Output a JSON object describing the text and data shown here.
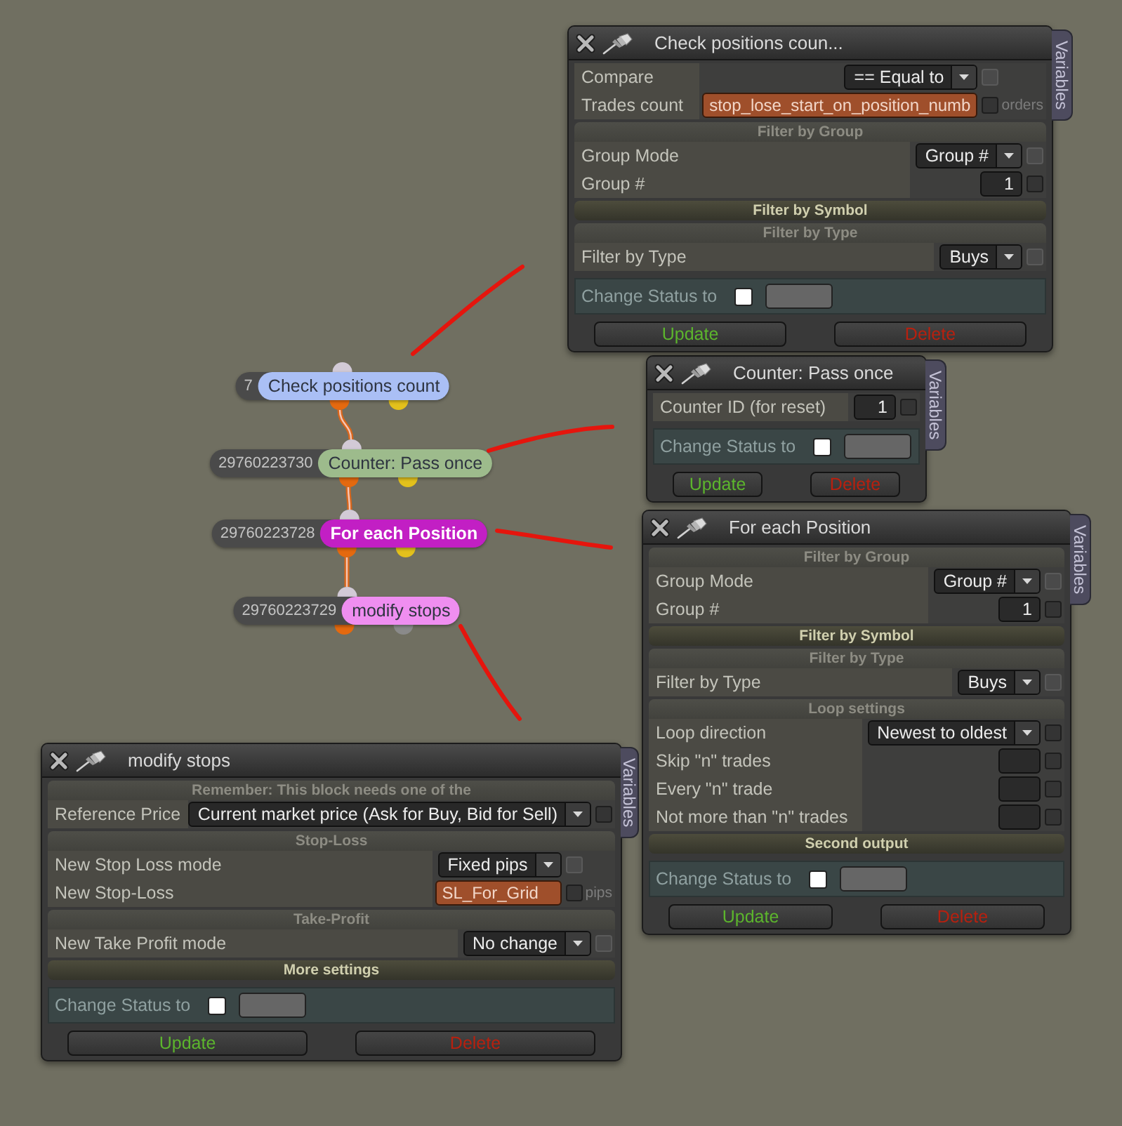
{
  "nodes": [
    {
      "id": "7",
      "label": "Check positions count",
      "color": "#aabff5",
      "selected": false,
      "second_port": {
        "color": "#e3c11c"
      }
    },
    {
      "id": "29760223730",
      "label": "Counter: Pass once",
      "color": "#9dbb8c",
      "selected": false,
      "second_port": {
        "color": "#e3c11c"
      }
    },
    {
      "id": "29760223728",
      "label": "For each Position",
      "color": "#c21fc4",
      "selected": true,
      "second_port": {
        "color": "#e3c11c"
      }
    },
    {
      "id": "29760223729",
      "label": "modify stops",
      "color": "#ef8ef0",
      "selected": false,
      "second_port": {
        "color": "#8a8a8a"
      }
    }
  ],
  "panels": [
    {
      "title": "Check positions coun...",
      "tab": "Variables",
      "sections": [
        {
          "rows": [
            {
              "label": "Compare",
              "kind": "select",
              "value": "== Equal to",
              "check": {
                "checked": false,
                "disabled": true
              }
            },
            {
              "label": "Trades count",
              "kind": "variable",
              "value": "stop_lose_start_on_position_numb",
              "check": {
                "checked": false,
                "disabled": false
              },
              "unit": "orders"
            }
          ]
        },
        {
          "title": "Filter by Group",
          "expanded": true,
          "rows": [
            {
              "label": "Group Mode",
              "kind": "select",
              "value": "Group #",
              "check": {
                "checked": false,
                "disabled": true
              }
            },
            {
              "label": "Group #",
              "kind": "input",
              "value": "1",
              "check": {
                "checked": false,
                "disabled": false
              }
            }
          ]
        },
        {
          "title": "Filter by Symbol",
          "expanded": false
        },
        {
          "title": "Filter by Type",
          "expanded": true,
          "rows": [
            {
              "label": "Filter by Type",
              "kind": "select",
              "value": "Buys",
              "check": {
                "checked": false,
                "disabled": true
              }
            }
          ]
        }
      ],
      "status": {
        "label": "Change Status to",
        "checked": false
      },
      "buttons": [
        {
          "label": "Update",
          "kind": "update"
        },
        {
          "label": "Delete",
          "kind": "delete"
        }
      ]
    },
    {
      "title": "Counter: Pass once",
      "tab": "Variables",
      "sections": [
        {
          "rows": [
            {
              "label": "Counter ID (for reset)",
              "kind": "input",
              "value": "1",
              "check": {
                "checked": false,
                "disabled": false
              }
            }
          ]
        }
      ],
      "status": {
        "label": "Change Status to",
        "checked": false
      },
      "buttons": [
        {
          "label": "Update",
          "kind": "update"
        },
        {
          "label": "Delete",
          "kind": "delete"
        }
      ]
    },
    {
      "title": "For each Position",
      "tab": "Variables",
      "sections": [
        {
          "title": "Filter by Group",
          "expanded": true,
          "rows": [
            {
              "label": "Group Mode",
              "kind": "select",
              "value": "Group #",
              "check": {
                "checked": false,
                "disabled": true
              }
            },
            {
              "label": "Group #",
              "kind": "input",
              "value": "1",
              "check": {
                "checked": false,
                "disabled": false
              }
            }
          ]
        },
        {
          "title": "Filter by Symbol",
          "expanded": false
        },
        {
          "title": "Filter by Type",
          "expanded": true,
          "rows": [
            {
              "label": "Filter by Type",
              "kind": "select",
              "value": "Buys",
              "check": {
                "checked": false,
                "disabled": true
              }
            }
          ]
        },
        {
          "title": "Loop settings",
          "expanded": true,
          "rows": [
            {
              "label": "Loop direction",
              "kind": "select",
              "value": "Newest to oldest",
              "check": {
                "checked": false,
                "disabled": false
              }
            },
            {
              "label": "Skip \"n\" trades",
              "kind": "input",
              "check": {
                "checked": false,
                "disabled": false
              }
            },
            {
              "label": "Every \"n\" trade",
              "kind": "input",
              "check": {
                "checked": false,
                "disabled": false
              }
            },
            {
              "label": "Not more than \"n\" trades",
              "kind": "input",
              "check": {
                "checked": false,
                "disabled": false
              }
            }
          ]
        },
        {
          "title": "Second output",
          "expanded": false
        }
      ],
      "status": {
        "label": "Change Status to",
        "checked": false
      },
      "buttons": [
        {
          "label": "Update",
          "kind": "update"
        },
        {
          "label": "Delete",
          "kind": "delete"
        }
      ]
    },
    {
      "title": "modify stops",
      "tab": "Variables",
      "sections": [
        {
          "title": "Remember: This block needs one of the",
          "expanded": true,
          "rows": [
            {
              "label": "Reference Price",
              "kind": "select",
              "value": "Current market price (Ask for Buy, Bid for Sell)",
              "check": {
                "checked": false,
                "disabled": false
              }
            }
          ]
        },
        {
          "title": "Stop-Loss",
          "expanded": true,
          "rows": [
            {
              "label": "New Stop Loss mode",
              "kind": "select",
              "value": "Fixed pips",
              "check": {
                "checked": false,
                "disabled": true
              }
            },
            {
              "label": "New Stop-Loss",
              "kind": "variable",
              "value": "SL_For_Grid",
              "check": {
                "checked": false,
                "disabled": false
              },
              "unit": "pips"
            }
          ]
        },
        {
          "title": "Take-Profit",
          "expanded": true,
          "rows": [
            {
              "label": "New Take Profit mode",
              "kind": "select",
              "value": "No change",
              "check": {
                "checked": false,
                "disabled": true
              }
            }
          ]
        },
        {
          "title": "More settings",
          "expanded": false
        }
      ],
      "status": {
        "label": "Change Status to",
        "checked": false
      },
      "buttons": [
        {
          "label": "Update",
          "kind": "update"
        },
        {
          "label": "Delete",
          "kind": "delete"
        }
      ]
    }
  ]
}
